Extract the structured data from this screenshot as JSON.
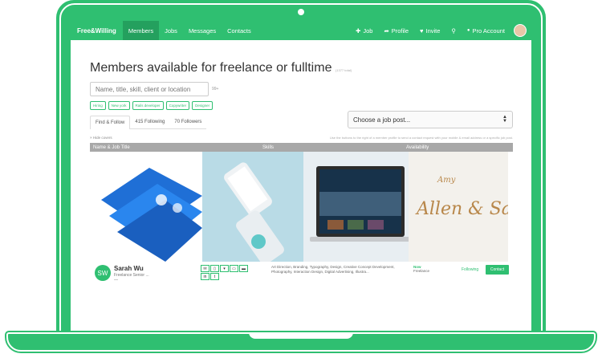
{
  "nav": {
    "brand": "Free&Willing",
    "items": [
      "Members",
      "Jobs",
      "Messages",
      "Contacts"
    ],
    "right": [
      {
        "icon": "plus-icon",
        "glyph": "✚",
        "label": "Job"
      },
      {
        "icon": "share-icon",
        "glyph": "➦",
        "label": "Profile"
      },
      {
        "icon": "heart-icon",
        "glyph": "♥",
        "label": "Invite"
      },
      {
        "icon": "search-icon",
        "glyph": "⚲",
        "label": ""
      },
      {
        "icon": "dot-icon",
        "glyph": "●",
        "label": "Pro Account"
      }
    ]
  },
  "page": {
    "title": "Members available for freelance or fulltime",
    "title_count": "(1377 total)",
    "search_placeholder": "Name, title, skill, client or location",
    "search_hint": "99+",
    "chips": [
      "Hiring",
      "New york",
      "Rails developer",
      "Copywriter",
      "Designer"
    ],
    "tabs": [
      "Find & Follow",
      "415 Following",
      "70 Followers"
    ],
    "select_label": "Choose a job post...",
    "hide_covers": "× Hide covers",
    "helper": "Use the buttons to the right of a member profile to send a contact request with your mobile & email address or a specific job post."
  },
  "table": {
    "headers": [
      "Name & Job Title",
      "Skills",
      "Availability"
    ]
  },
  "member": {
    "initials": "SW",
    "name": "Sarah Wu",
    "role": "Freelance Senior ...",
    "dash": "—",
    "skills": "Art Direction, Branding, Typography, Design, Creative Concept Development, Photography, Interaction Design, Digital Advertising, Illustra...",
    "avail_now": "Now",
    "avail_kind": "Freelance",
    "following": "Following",
    "contact": "Contact",
    "contact_icons": [
      [
        "✉",
        "▯",
        "▾",
        "▭",
        "▬"
      ],
      [
        "in",
        "t"
      ]
    ],
    "cover_text": {
      "top": "Amy",
      "main": "Allen & Sarah"
    }
  },
  "colors": {
    "brand": "#2fbf71",
    "header_gray": "#a8a8a8"
  }
}
